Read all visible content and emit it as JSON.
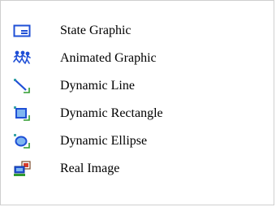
{
  "menu": {
    "items": [
      {
        "label": "State Graphic",
        "icon": "state-graphic-icon"
      },
      {
        "label": "Animated Graphic",
        "icon": "animated-graphic-icon"
      },
      {
        "label": "Dynamic Line",
        "icon": "dynamic-line-icon"
      },
      {
        "label": "Dynamic Rectangle",
        "icon": "dynamic-rectangle-icon"
      },
      {
        "label": "Dynamic Ellipse",
        "icon": "dynamic-ellipse-icon"
      },
      {
        "label": "Real Image",
        "icon": "real-image-icon"
      }
    ]
  },
  "colors": {
    "icon_blue": "#1f4fd6",
    "icon_green": "#2e9b2e",
    "icon_teal": "#3aa6a6",
    "icon_red": "#d63a2a"
  }
}
